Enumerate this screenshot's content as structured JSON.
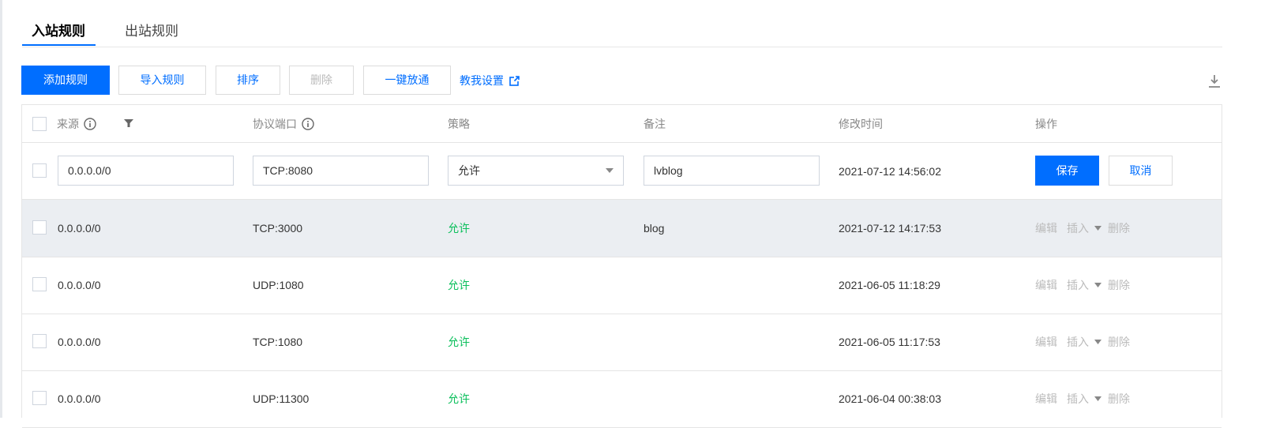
{
  "tabs": [
    {
      "label": "入站规则",
      "active": true
    },
    {
      "label": "出站规则",
      "active": false
    }
  ],
  "toolbar": {
    "add_label": "添加规则",
    "import_label": "导入规则",
    "sort_label": "排序",
    "delete_label": "删除",
    "allow_all_label": "一键放通",
    "help_link": "教我设置"
  },
  "table": {
    "headers": {
      "source": "来源",
      "port": "协议端口",
      "policy": "策略",
      "note": "备注",
      "modified": "修改时间",
      "actions": "操作"
    },
    "edit_row": {
      "source": "0.0.0.0/0",
      "port": "TCP:8080",
      "policy": "允许",
      "note": "lvblog",
      "modified": "2021-07-12 14:56:02",
      "save_label": "保存",
      "cancel_label": "取消"
    },
    "rows": [
      {
        "source": "0.0.0.0/0",
        "port": "TCP:3000",
        "policy": "允许",
        "note": "blog",
        "modified": "2021-07-12 14:17:53"
      },
      {
        "source": "0.0.0.0/0",
        "port": "UDP:1080",
        "policy": "允许",
        "note": "",
        "modified": "2021-06-05 11:18:29"
      },
      {
        "source": "0.0.0.0/0",
        "port": "TCP:1080",
        "policy": "允许",
        "note": "",
        "modified": "2021-06-05 11:17:53"
      },
      {
        "source": "0.0.0.0/0",
        "port": "UDP:11300",
        "policy": "允许",
        "note": "",
        "modified": "2021-06-04 00:38:03"
      }
    ],
    "row_actions": {
      "edit": "编辑",
      "insert": "插入",
      "delete": "删除"
    }
  },
  "colors": {
    "primary": "#006eff",
    "allow": "#0abf5b",
    "disabled": "#bbbbbb",
    "hover_row": "#ebeef2"
  },
  "icons": [
    "info-icon",
    "filter-icon",
    "external-link-icon",
    "download-icon",
    "caret-down-icon"
  ]
}
